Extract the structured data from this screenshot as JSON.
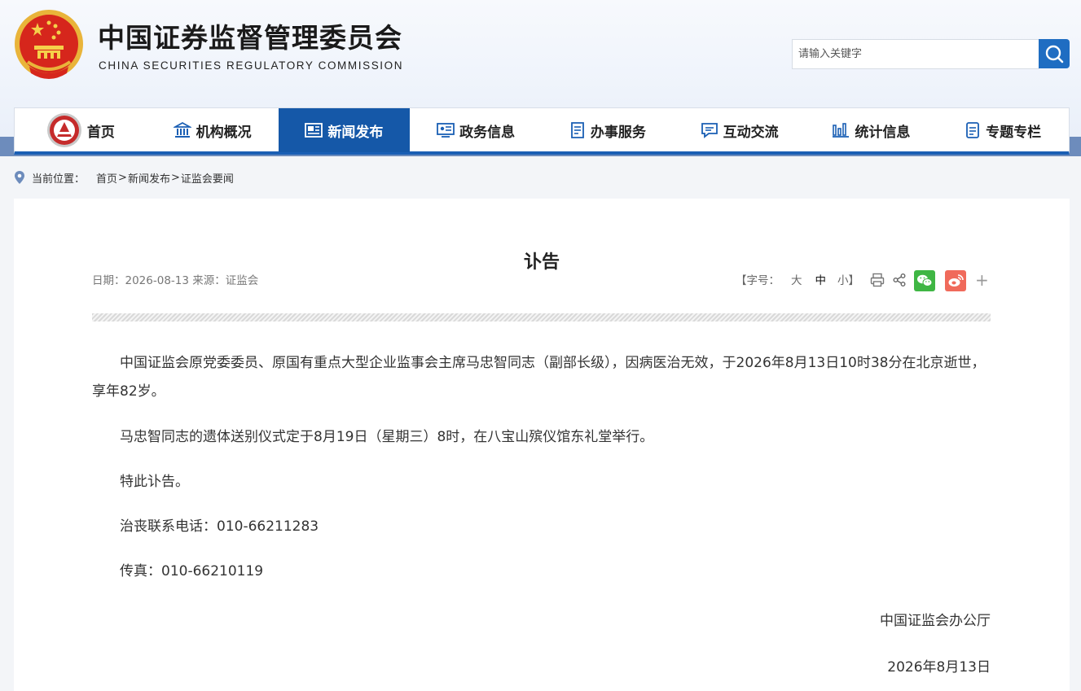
{
  "header": {
    "title": "中国证券监督管理委员会",
    "subtitle": "CHINA SECURITIES REGULATORY COMMISSION",
    "search_placeholder": "请输入关键字"
  },
  "nav": {
    "items": [
      {
        "label": "首页",
        "icon": "emblem-icon"
      },
      {
        "label": "机构概况",
        "icon": "building-icon"
      },
      {
        "label": "新闻发布",
        "icon": "news-icon"
      },
      {
        "label": "政务信息",
        "icon": "monitor-icon"
      },
      {
        "label": "办事服务",
        "icon": "document-icon"
      },
      {
        "label": "互动交流",
        "icon": "chat-icon"
      },
      {
        "label": "统计信息",
        "icon": "bar-chart-icon"
      },
      {
        "label": "专题专栏",
        "icon": "list-icon"
      }
    ],
    "active": "新闻发布"
  },
  "breadcrumb": {
    "label": "当前位置：",
    "items": [
      "首页",
      "新闻发布",
      "证监会要闻"
    ],
    "separator": ">"
  },
  "article": {
    "title": "讣告",
    "meta": "日期：2026-08-13 来源：证监会",
    "font_size_label": "【字号：",
    "font_sizes": [
      "大",
      "中",
      "小】"
    ],
    "paragraphs": [
      "中国证监会原党委委员、原国有重点大型企业监事会主席马忠智同志（副部长级），因病医治无效，于2026年8月13日10时38分在北京逝世，享年82岁。",
      "马忠智同志的遗体送别仪式定于8月19日（星期三）8时，在八宝山殡仪馆东礼堂举行。",
      "特此讣告。",
      "治丧联系电话：010-66211283",
      "传真：010-66210119"
    ],
    "signature": "中国证监会办公厅",
    "date": "2026年8月13日"
  },
  "share": {
    "icons": [
      "print-icon",
      "share-icon",
      "wechat-icon",
      "weibo-icon",
      "plus-icon"
    ],
    "plus": "+"
  },
  "colors": {
    "nav_active": "#1558a8",
    "search_button": "#1f6dc2",
    "wechat": "#3fb644",
    "weibo": "#f06a5b"
  }
}
